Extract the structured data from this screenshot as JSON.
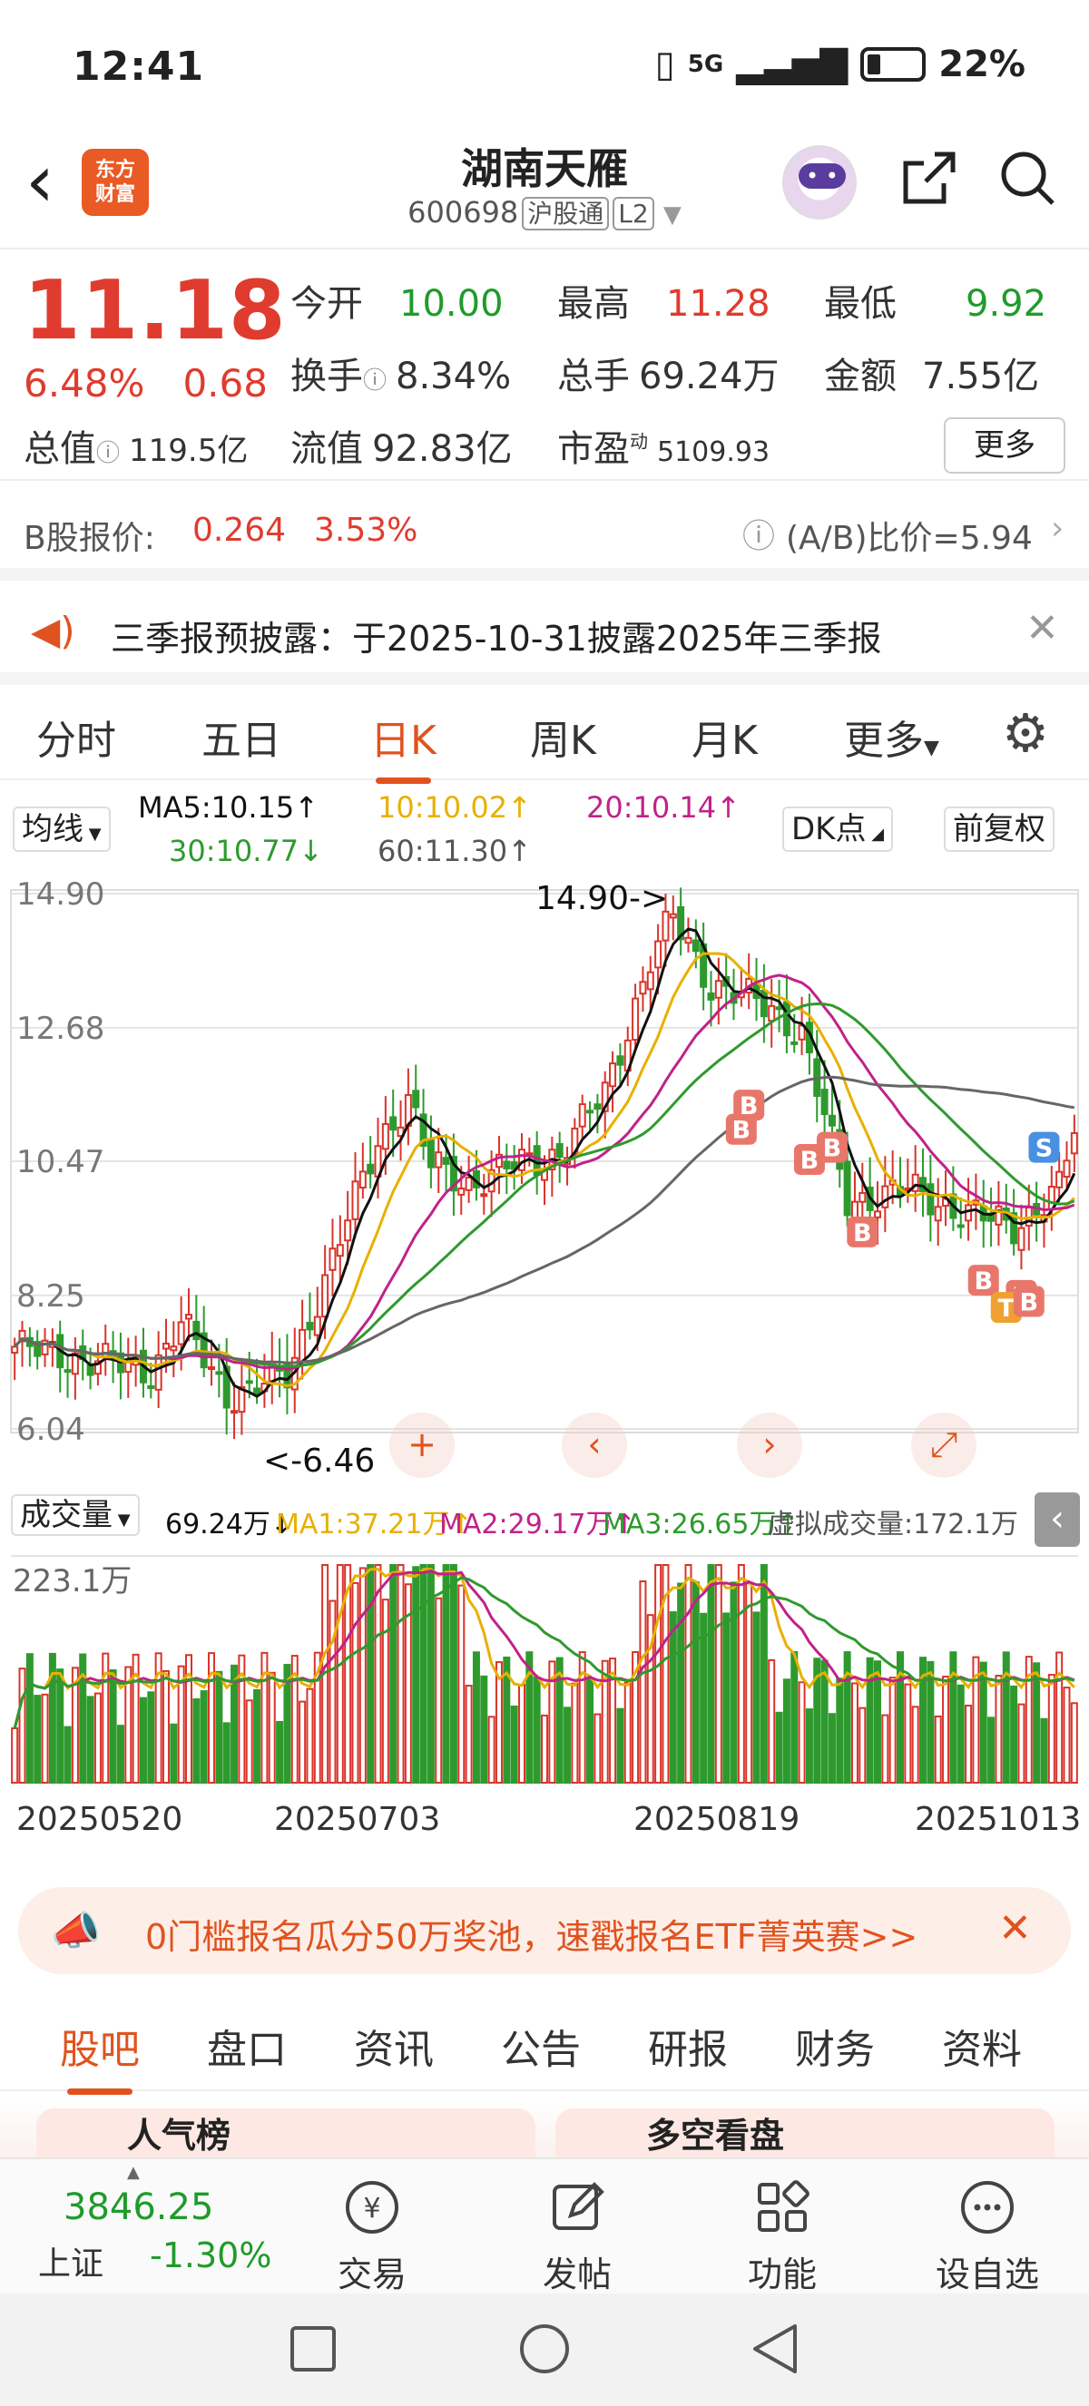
{
  "status_bar": {
    "time": "12:41",
    "network": "5G",
    "battery": "22%"
  },
  "header": {
    "title": "湖南天雁",
    "code": "600698",
    "market_tag": "沪股通",
    "level_tag": "L2",
    "logo_line1": "东方",
    "logo_line2": "财富"
  },
  "quote": {
    "price": "11.18",
    "change_pct": "6.48%",
    "change_amt": "0.68",
    "open_label": "今开",
    "open": "10.00",
    "high_label": "最高",
    "high": "11.28",
    "low_label": "最低",
    "low": "9.92",
    "turnover_label": "换手",
    "turnover": "8.34%",
    "volume_label": "总手",
    "volume": "69.24万",
    "amount_label": "金额",
    "amount": "7.55亿",
    "mktcap_label": "总值",
    "mktcap": "119.5亿",
    "float_label": "流值",
    "float_cap": "92.83亿",
    "pe_label": "市盈",
    "pe_sup": "动",
    "pe": "5109.93",
    "more_label": "更多"
  },
  "b_share": {
    "label": "B股报价:",
    "price": "0.264",
    "pct": "3.53%",
    "ratio": "(A/B)比价=5.94"
  },
  "notice": {
    "text": "三季报预披露：于2025-10-31披露2025年三季报"
  },
  "chart_tabs": [
    "分时",
    "五日",
    "日K",
    "周K",
    "月K",
    "更多"
  ],
  "ma": {
    "type_label": "均线",
    "ma5": "MA5:10.15↑",
    "ma10": "10:10.02↑",
    "ma20": "20:10.14↑",
    "ma30": "30:10.77↓",
    "ma60": "60:11.30↑",
    "dk_label": "DK点",
    "adjust_label": "前复权",
    "colors": {
      "ma5": "#111111",
      "ma10": "#e8b000",
      "ma20": "#c0228a",
      "ma30": "#2e9a2e",
      "ma60": "#666666"
    }
  },
  "chart_data": {
    "type": "candlestick",
    "price_axis_labels": [
      "14.90",
      "12.68",
      "10.47",
      "8.25",
      "6.04"
    ],
    "ylim": [
      6.04,
      14.9
    ],
    "max_annotation": "14.90->",
    "min_annotation": "<-6.46",
    "date_labels": [
      "20250520",
      "20250703",
      "20250819",
      "20251013"
    ],
    "signals": [
      "B",
      "B",
      "B",
      "B",
      "B",
      "B",
      "B",
      "S",
      "T",
      "B"
    ],
    "volume_indicator": {
      "name": "成交量",
      "value": "69.24万↓",
      "ma1": "MA1:37.21万↑",
      "ma2": "MA2:29.17万↑",
      "ma3": "MA3:26.65万↑",
      "virtual": "虚拟成交量:172.1万",
      "axis_max": "223.1万"
    }
  },
  "promo": {
    "text": "0门槛报名瓜分50万奖池，速戳报名ETF菁英赛>>"
  },
  "bottom_tabs": [
    "股吧",
    "盘口",
    "资讯",
    "公告",
    "研报",
    "财务",
    "资料"
  ],
  "peek_cards": [
    "人气榜",
    "多空看盘"
  ],
  "index": {
    "value": "3846.25",
    "name": "上证",
    "pct": "-1.30%"
  },
  "bottom_nav": [
    "交易",
    "发帖",
    "功能",
    "设自选"
  ]
}
